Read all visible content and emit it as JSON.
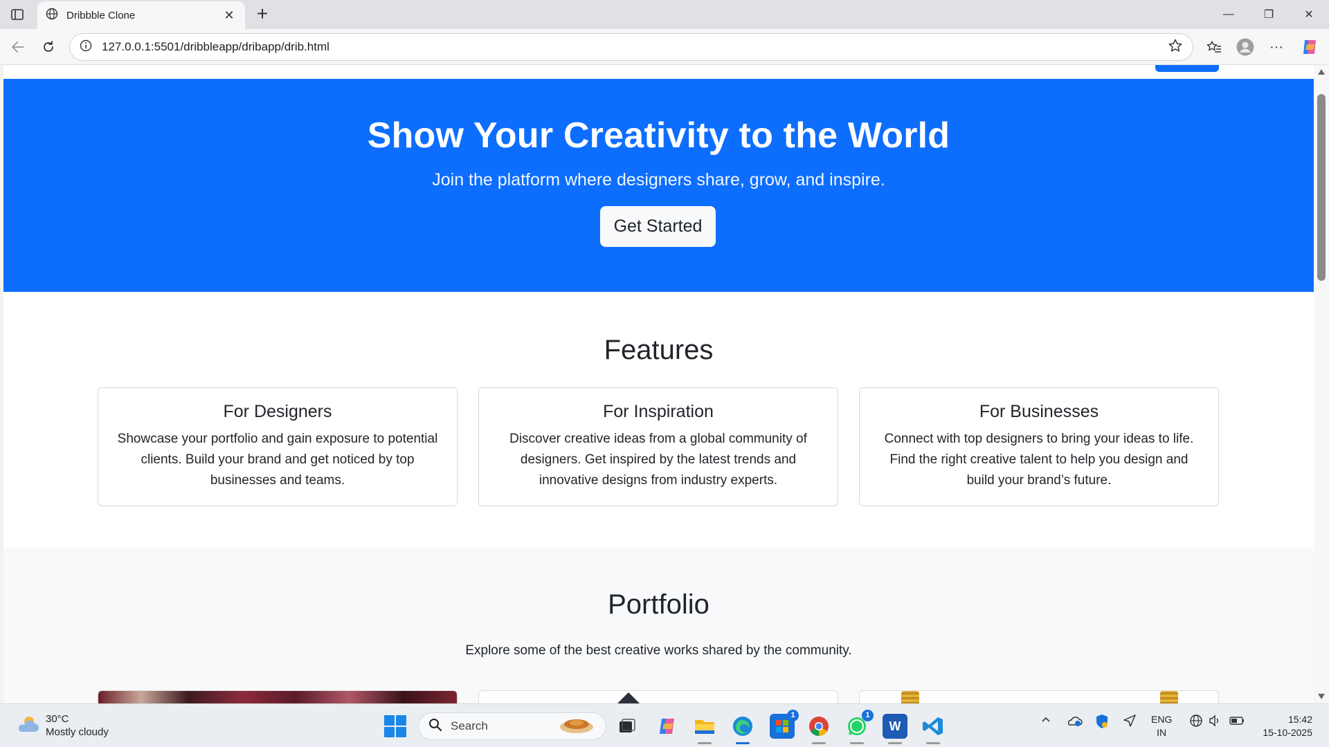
{
  "browser": {
    "tab_title": "Dribbble Clone",
    "url": "127.0.0.1:5501/dribbleapp/dribapp/drib.html",
    "tab_close": "✕",
    "new_tab": "+",
    "minimize": "—",
    "restore": "❐",
    "close": "✕"
  },
  "hero": {
    "title": "Show Your Creativity to the World",
    "subtitle": "Join the platform where designers share, grow, and inspire.",
    "cta_label": "Get Started",
    "background": "#0d6efd"
  },
  "features": {
    "title": "Features",
    "cards": [
      {
        "title": "For Designers",
        "text": "Showcase your portfolio and gain exposure to potential clients. Build your brand and get noticed by top businesses and teams."
      },
      {
        "title": "For Inspiration",
        "text": "Discover creative ideas from a global community of designers. Get inspired by the latest trends and innovative designs from industry experts."
      },
      {
        "title": "For Businesses",
        "text": "Connect with top designers to bring your ideas to life. Find the right creative talent to help you design and build your brand’s future."
      }
    ]
  },
  "portfolio": {
    "title": "Portfolio",
    "subtitle": "Explore some of the best creative works shared by the community."
  },
  "taskbar": {
    "weather_temp": "30°C",
    "weather_desc": "Mostly cloudy",
    "search_label": "Search",
    "apps": [
      {
        "icon": "task-view-icon",
        "color": "#2b2b2b"
      },
      {
        "icon": "copilot-icon",
        "color": "#8a5cf6"
      },
      {
        "icon": "file-explorer-icon",
        "color": "#f2b81c"
      },
      {
        "icon": "edge-icon",
        "color": "#1a8ad8"
      },
      {
        "icon": "microsoft-store-icon",
        "color": "#1a6fd8",
        "badge": "1"
      },
      {
        "icon": "chrome-icon",
        "color": "#db4437"
      },
      {
        "icon": "whatsapp-icon",
        "color": "#25d366",
        "badge": "1"
      },
      {
        "icon": "word-icon",
        "color": "#1f5ab5",
        "letter": "W"
      },
      {
        "icon": "vscode-icon",
        "color": "#1f8ad8"
      }
    ],
    "lang_top": "ENG",
    "lang_bottom": "IN",
    "time": "15:42",
    "date": "15-10-2025"
  }
}
